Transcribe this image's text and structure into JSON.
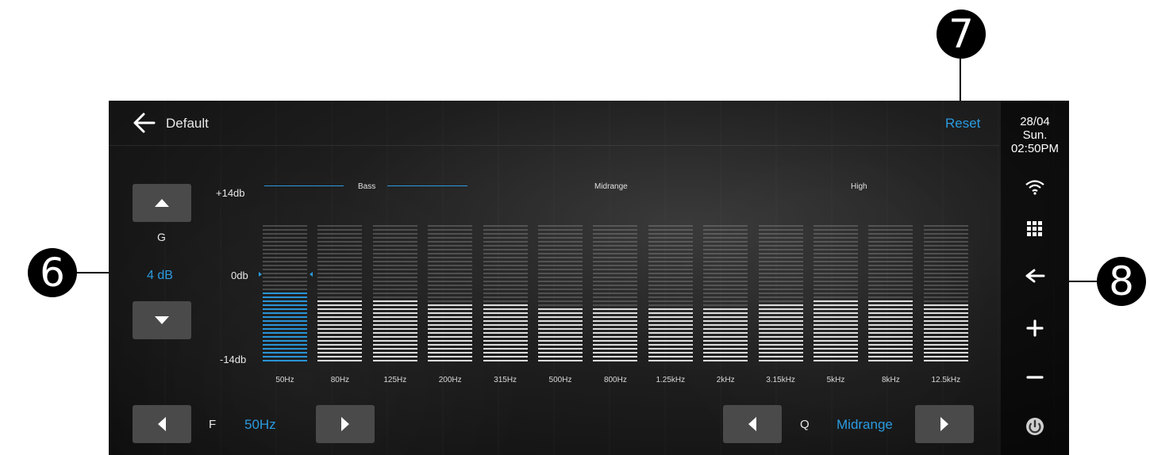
{
  "header": {
    "title": "Default",
    "reset_label": "Reset"
  },
  "status": {
    "date": "28/04",
    "day": "Sun.",
    "time": "02:50PM"
  },
  "gain": {
    "label": "G",
    "value": "4 dB"
  },
  "scale": {
    "top": "+14db",
    "mid": "0db",
    "bottom": "-14db"
  },
  "sections": {
    "bass": "Bass",
    "midrange": "Midrange",
    "high": "High"
  },
  "bands": [
    {
      "freq": "50Hz",
      "level_db": 0,
      "selected": true
    },
    {
      "freq": "80Hz",
      "level_db": -1,
      "selected": false
    },
    {
      "freq": "125Hz",
      "level_db": -1,
      "selected": false
    },
    {
      "freq": "200Hz",
      "level_db": -2,
      "selected": false
    },
    {
      "freq": "315Hz",
      "level_db": -2,
      "selected": false
    },
    {
      "freq": "500Hz",
      "level_db": -3,
      "selected": false
    },
    {
      "freq": "800Hz",
      "level_db": -3,
      "selected": false
    },
    {
      "freq": "1.25kHz",
      "level_db": -3,
      "selected": false
    },
    {
      "freq": "2kHz",
      "level_db": -3,
      "selected": false
    },
    {
      "freq": "3.15kHz",
      "level_db": -2,
      "selected": false
    },
    {
      "freq": "5kHz",
      "level_db": -1,
      "selected": false
    },
    {
      "freq": "8kHz",
      "level_db": -1,
      "selected": false
    },
    {
      "freq": "12.5kHz",
      "level_db": -2,
      "selected": false
    }
  ],
  "frequency": {
    "label": "F",
    "value": "50Hz"
  },
  "q": {
    "label": "Q",
    "value": "Midrange"
  },
  "callouts": {
    "six": "6",
    "seven": "7",
    "eight": "8"
  },
  "colors": {
    "accent": "#2a9be0",
    "bar_active": "#2a9be0",
    "bar_inactive": "#e8e8e8"
  },
  "icons": {
    "back": "arrow-left-icon",
    "wifi": "wifi-icon",
    "apps": "app-grid-icon",
    "return": "return-arrow-icon",
    "volume_up": "plus-icon",
    "volume_down": "minus-icon",
    "power": "power-icon",
    "up": "triangle-up-icon",
    "down": "triangle-down-icon",
    "left": "triangle-left-icon",
    "right": "triangle-right-icon"
  }
}
